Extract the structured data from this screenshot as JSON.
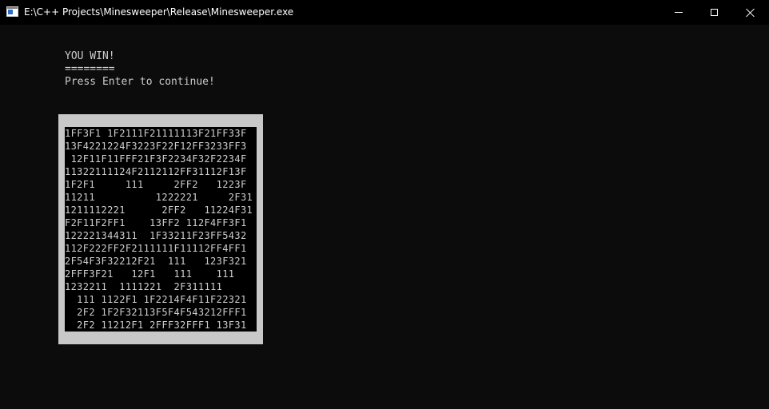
{
  "window": {
    "title": "E:\\C++ Projects\\Minesweeper\\Release\\Minesweeper.exe",
    "controls": {
      "minimize_icon": "minimize-icon",
      "maximize_icon": "maximize-icon",
      "close_icon": "close-icon"
    }
  },
  "console": {
    "lines": [
      "YOU WIN!",
      "========",
      "Press Enter to continue!"
    ],
    "board": {
      "rows": [
        "1FF3F1 1F2111F21111113F21FF33F",
        "13F4221224F3223F22F12FF3233FF3",
        " 12F11F11FFF21F3F2234F32F2234F",
        "11322111124F2112112FF31112F13F",
        "1F2F1     111     2FF2   1223F",
        "11211          1222221     2F31",
        "1211112221      2FF2   11224F31",
        "F2F11F2FF1    13FF2 112F4FF3F1",
        "122221344311  1F33211F23FF5432",
        "112F222FF2F2111111F11112FF4FF1",
        "2F54F3F32212F21  111   123F321",
        "2FFF3F21   12F1   111    111",
        "1232211  1111221  2F311111",
        "  111 1122F1 1F2214F4F11F22321",
        "  2F2 1F2F32113F5F4F543212FFF1",
        "  2F2 11212F1 2FFF32FFF1 13F31"
      ]
    }
  },
  "colors": {
    "background": "#0c0c0c",
    "titlebar": "#000000",
    "text": "#cccccc",
    "board_frame": "#c8c8c8"
  }
}
